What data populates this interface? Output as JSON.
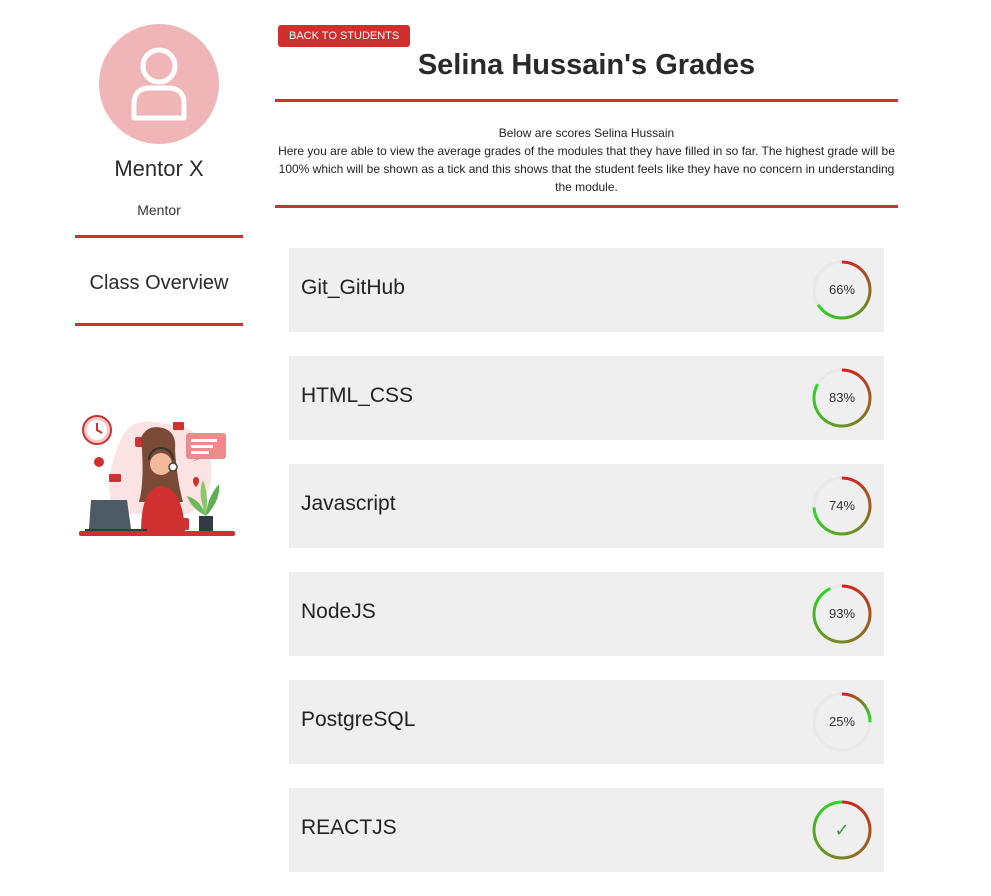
{
  "sidebar": {
    "mentor_name": "Mentor X",
    "mentor_role": "Mentor",
    "class_overview": "Class Overview"
  },
  "header": {
    "back_button": "BACK TO STUDENTS",
    "title": "Selina Hussain's Grades"
  },
  "intro": {
    "line1": "Below are scores Selina Hussain",
    "line2": "Here you are able to view the average grades of the modules that they have filled in so far. The highest grade will be 100% which will be shown as a tick and this shows that the student feels like they have no concern in understanding the module."
  },
  "modules": [
    {
      "name": "Git_GitHub",
      "percent": 66,
      "label": "66%"
    },
    {
      "name": "HTML_CSS",
      "percent": 83,
      "label": "83%"
    },
    {
      "name": "Javascript",
      "percent": 74,
      "label": "74%"
    },
    {
      "name": "NodeJS",
      "percent": 93,
      "label": "93%"
    },
    {
      "name": "PostgreSQL",
      "percent": 25,
      "label": "25%"
    },
    {
      "name": "REACTJS",
      "percent": 100,
      "label": "✓"
    }
  ],
  "colors": {
    "accent": "#d0302f",
    "avatar_bg": "#f0b6b7",
    "ring_start": "#d62020",
    "ring_end": "#22dd22",
    "card_bg": "#efefef"
  }
}
